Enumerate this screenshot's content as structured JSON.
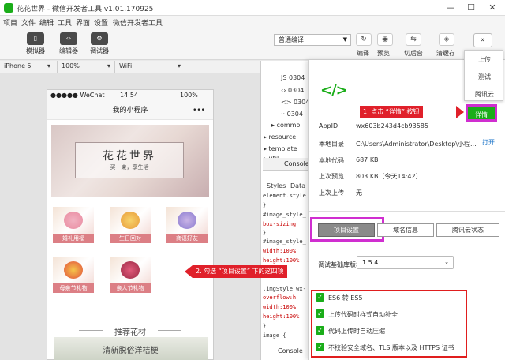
{
  "window": {
    "title": "花花世界 - 微信开发者工具 v1.01.170925",
    "min": "—",
    "max": "☐",
    "close": "✕"
  },
  "menu": [
    "项目",
    "文件",
    "编辑",
    "工具",
    "界面",
    "设置",
    "微信开发者工具"
  ],
  "toolbar": {
    "left": [
      {
        "label": "模拟器",
        "icon": "phone-icon",
        "glyph": "▯"
      },
      {
        "label": "编辑器",
        "icon": "code-icon",
        "glyph": "‹›"
      },
      {
        "label": "调试器",
        "icon": "debug-icon",
        "glyph": "⚙"
      }
    ],
    "compile_mode": "普通编译",
    "right": [
      {
        "label": "编译",
        "glyph": "↻"
      },
      {
        "label": "预览",
        "glyph": "◉"
      },
      {
        "label": "切后台",
        "glyph": "⇆"
      },
      {
        "label": "清缓存",
        "glyph": "◈"
      }
    ],
    "more": "»"
  },
  "devbar": {
    "device": "iPhone 5",
    "zoom": "100%",
    "network": "WiFi"
  },
  "phone": {
    "carrier": "●●●●● WeChat",
    "time": "14:54",
    "battery": "100%",
    "nav_title": "我的小程序",
    "menu_dots": "•••",
    "banner_title": "花花世界",
    "banner_sub": "一 买一束，享生活 一",
    "products": [
      "婚礼用福",
      "生日回对",
      "商语好友",
      "母亲节礼物",
      "亲人节礼物"
    ],
    "recommend": "推荐花材",
    "bottom_text": "清新脱俗洋桔梗"
  },
  "editor": {
    "files": [
      "JS 0304",
      "‹› 0304",
      "<> 0304",
      "·· 0304",
      "▸ commo",
      "▸ resource",
      "▸ template",
      "▸ util"
    ],
    "devtab": "Console",
    "styles_tab": "Styles",
    "data_tab": "Data",
    "code": [
      "element.style",
      "}",
      "#image_style_",
      "  box-sizing",
      "}",
      "#image_style_",
      "  width:100%",
      "  height:100%",
      "}",
      ".imgStyle wx-",
      "  overflow:h",
      "  width:100%",
      "  height:100%",
      "}",
      "image {"
    ],
    "bottom_tab": "Console"
  },
  "menu_dropdown": [
    "上传",
    "测试",
    "腾讯云"
  ],
  "detail_button": "详情",
  "details": {
    "appid_label": "AppID",
    "appid": "wx603b243d4cb93585",
    "dir_label": "本地目录",
    "dir": "C:\\Users\\Administrator\\Desktop\\小程...",
    "open": "打开",
    "code_label": "本地代码",
    "code": "687 KB",
    "preview_label": "上次预览",
    "preview": "803 KB（今天14:42）",
    "upload_label": "上次上传",
    "upload": "无",
    "tabs": [
      "项目设置",
      "域名信息",
      "腾讯云状态"
    ],
    "sdk_label": "调试基础库版本",
    "sdk_version": "1.5.4",
    "options": [
      "ES6 转 ES5",
      "上传代码时样式自动补全",
      "代码上传时自动压缩",
      "不校验安全域名、TLS 版本以及 HTTPS 证书"
    ]
  },
  "annotations": {
    "step1": "1. 点击 “详情” 按钮",
    "step2": "2. 勾选 “项目设置” 下的这四项"
  },
  "colors": {
    "accent": "#1aad19",
    "highlight": "#d02ed0",
    "annotation": "#e0202a"
  }
}
